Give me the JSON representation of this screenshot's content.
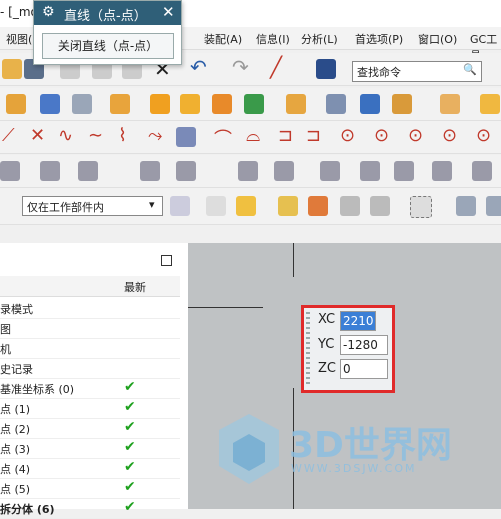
{
  "window": {
    "title": "- [_mo"
  },
  "popup": {
    "title": "直线（点-点）",
    "close_button_label": "关闭直线（点-点）"
  },
  "menubar": {
    "items": [
      "视图(",
      "装配(A)",
      "信息(I)",
      "分析(L)",
      "首选项(P)",
      "窗口(O)",
      "GC工具"
    ]
  },
  "search": {
    "placeholder": "查找命令"
  },
  "filter": {
    "selected": "仅在工作部件内"
  },
  "nav": {
    "header_latest": "最新",
    "rows": [
      {
        "label": "录模式",
        "checked": false
      },
      {
        "label": "图",
        "checked": false
      },
      {
        "label": "机",
        "checked": false
      },
      {
        "label": "史记录",
        "checked": false
      },
      {
        "label": "基准坐标系 (0)",
        "checked": true
      },
      {
        "label": "点 (1)",
        "checked": true
      },
      {
        "label": "点 (2)",
        "checked": true
      },
      {
        "label": "点 (3)",
        "checked": true
      },
      {
        "label": "点 (4)",
        "checked": true
      },
      {
        "label": "点 (5)",
        "checked": true
      },
      {
        "label": "拆分体 (6)",
        "checked": true
      }
    ]
  },
  "coords": {
    "xc_label": "XC",
    "xc_value": "2210",
    "yc_label": "YC",
    "yc_value": "-1280",
    "zc_label": "ZC",
    "zc_value": "0"
  },
  "watermark": {
    "brand": "3D世界网",
    "url": "WWW.3DSJW.COM"
  }
}
